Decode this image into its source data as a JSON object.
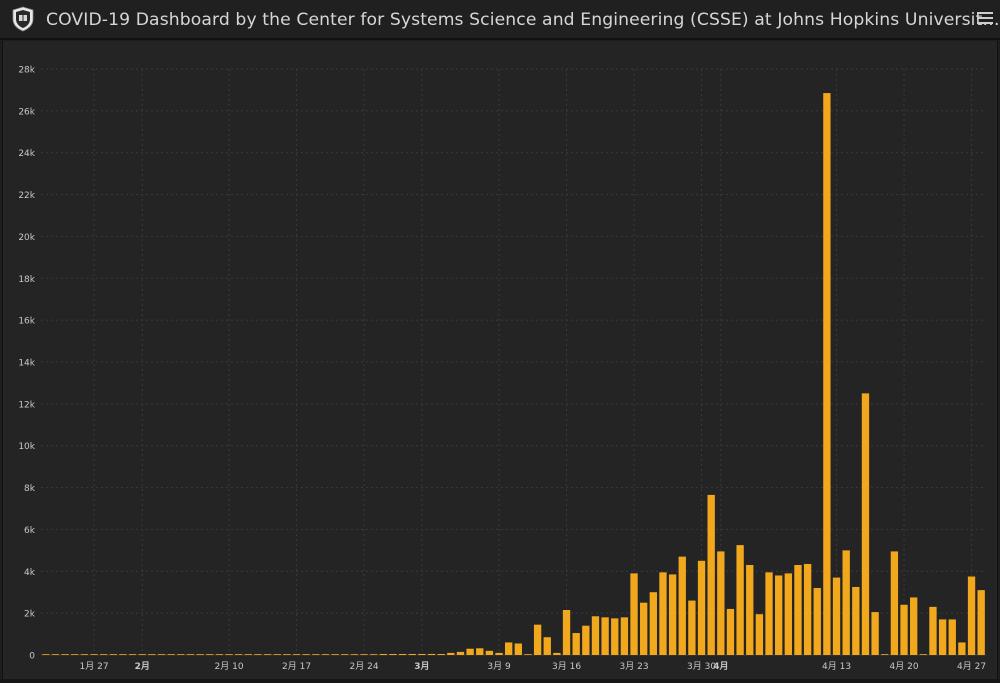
{
  "header": {
    "title": "COVID-19 Dashboard by the Center for Systems Science and Engineering (CSSE) at Johns Hopkins Universit…",
    "logo_icon": "university-shield-icon",
    "menu_icon": "hamburger-menu-icon"
  },
  "colors": {
    "bar": "#f2a81d",
    "background": "#242424",
    "grid": "#3a3a3a",
    "tick_text": "#c8c8c8"
  },
  "chart_data": {
    "type": "bar",
    "x_start": "1月22",
    "ylim": [
      0,
      28000
    ],
    "yticks": [
      0,
      2000,
      4000,
      6000,
      8000,
      10000,
      12000,
      14000,
      16000,
      18000,
      20000,
      22000,
      24000,
      26000,
      28000
    ],
    "ytick_labels": [
      "0",
      "2k",
      "4k",
      "6k",
      "8k",
      "10k",
      "12k",
      "14k",
      "16k",
      "18k",
      "20k",
      "22k",
      "24k",
      "26k",
      "28k"
    ],
    "xticks": [
      {
        "label": "1月 27",
        "index": 5,
        "bold": false
      },
      {
        "label": "2月",
        "index": 10,
        "bold": true
      },
      {
        "label": "2月 10",
        "index": 19,
        "bold": false
      },
      {
        "label": "2月 17",
        "index": 26,
        "bold": false
      },
      {
        "label": "2月 24",
        "index": 33,
        "bold": false
      },
      {
        "label": "3月",
        "index": 39,
        "bold": true
      },
      {
        "label": "3月 9",
        "index": 47,
        "bold": false
      },
      {
        "label": "3月 16",
        "index": 54,
        "bold": false
      },
      {
        "label": "3月 23",
        "index": 61,
        "bold": false
      },
      {
        "label": "3月 30",
        "index": 68,
        "bold": false
      },
      {
        "label": "4月",
        "index": 70,
        "bold": true
      },
      {
        "label": "4月 13",
        "index": 82,
        "bold": false
      },
      {
        "label": "4月 20",
        "index": 89,
        "bold": false
      },
      {
        "label": "4月 27",
        "index": 96,
        "bold": false
      }
    ],
    "grid": true,
    "values": [
      0,
      0,
      0,
      0,
      0,
      0,
      0,
      0,
      0,
      0,
      0,
      0,
      0,
      0,
      0,
      0,
      0,
      0,
      0,
      0,
      0,
      0,
      0,
      0,
      0,
      0,
      0,
      0,
      0,
      0,
      0,
      0,
      0,
      0,
      0,
      10,
      20,
      30,
      30,
      40,
      50,
      30,
      100,
      150,
      300,
      320,
      200,
      100,
      600,
      550,
      0,
      1450,
      850,
      100,
      2150,
      1050,
      1400,
      1850,
      1800,
      1750,
      1800,
      3900,
      2500,
      3000,
      3950,
      3850,
      4700,
      2600,
      4500,
      7650,
      4950,
      2200,
      5250,
      4300,
      1950,
      3950,
      3800,
      3900,
      4300,
      4350,
      3200,
      26850,
      3700,
      5000,
      3250,
      12500,
      2050,
      0,
      4950,
      2400,
      2750,
      0,
      2300,
      1700,
      1700,
      600,
      3750,
      3100
    ]
  }
}
